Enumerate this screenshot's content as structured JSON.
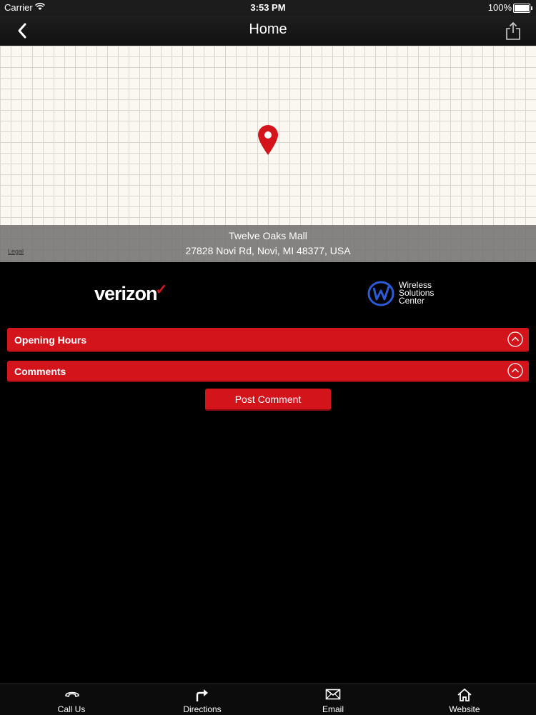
{
  "status_bar": {
    "carrier": "Carrier",
    "time": "3:53 PM",
    "battery": "100%"
  },
  "nav": {
    "title": "Home",
    "back_icon": "chevron-left-icon",
    "share_icon": "share-icon"
  },
  "map": {
    "place_name": "Twelve Oaks Mall",
    "address": "27828 Novi Rd, Novi, MI 48377, USA",
    "legal": "Legal",
    "pin_color": "#d3141b"
  },
  "logos": {
    "verizon": "verizon",
    "wsc_line1": "Wireless",
    "wsc_line2": "Solutions",
    "wsc_line3": "Center"
  },
  "sections": {
    "opening_hours": "Opening Hours",
    "comments": "Comments"
  },
  "post_comment": "Post Comment",
  "tabs": [
    {
      "label": "Call Us",
      "icon": "phone-icon"
    },
    {
      "label": "Directions",
      "icon": "directions-arrow-icon"
    },
    {
      "label": "Email",
      "icon": "envelope-icon"
    },
    {
      "label": "Website",
      "icon": "home-icon"
    }
  ],
  "colors": {
    "accent": "#d3141b",
    "background": "#000000"
  }
}
